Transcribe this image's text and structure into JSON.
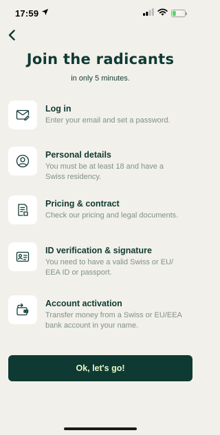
{
  "status_bar": {
    "time": "17:59",
    "battery": "32",
    "battery_fraction": 0.32,
    "icons": [
      "location-arrow-icon",
      "signal-icon",
      "wifi-icon",
      "battery-icon"
    ]
  },
  "header": {
    "back_icon": "chevron-left-icon",
    "title": "Join the radicants",
    "subtitle": "in only 5 minutes."
  },
  "steps": [
    {
      "icon": "envelope-edit-icon",
      "title": "Log in",
      "description": [
        "Enter your email and set a password."
      ]
    },
    {
      "icon": "user-circle-icon",
      "title": "Personal details",
      "description": [
        "You must be at least 18 and have a",
        "Swiss residency."
      ]
    },
    {
      "icon": "document-icon",
      "title": "Pricing & contract",
      "description": [
        "Check our pricing and legal documents."
      ]
    },
    {
      "icon": "id-card-icon",
      "title": "ID verification & signature",
      "description": [
        "You need to have a valid Swiss or EU/",
        "EEA ID or passport."
      ]
    },
    {
      "icon": "wallet-transfer-icon",
      "title": "Account activation",
      "description": [
        "Transfer money from a Swiss or EU/EEA",
        "bank account in your name."
      ]
    }
  ],
  "cta": {
    "label": "Ok, let's go!"
  },
  "colors": {
    "background": "#f2f0ea",
    "primary": "#0e3a33",
    "cta_text": "#ecf7c8",
    "muted_text": "#7f918a",
    "battery": "#4cd964"
  }
}
